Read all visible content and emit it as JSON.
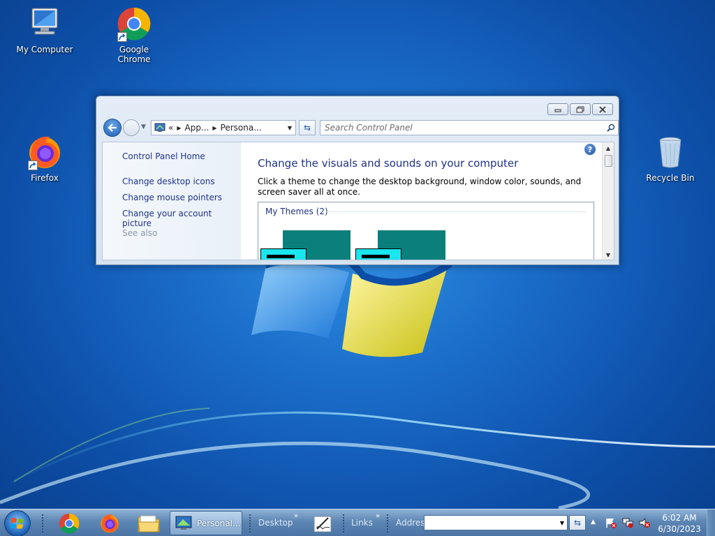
{
  "desktop": {
    "icons": [
      {
        "label": "My Computer",
        "icon": "computer-icon"
      },
      {
        "label": "Google Chrome",
        "icon": "chrome-icon"
      },
      {
        "label": "Firefox",
        "icon": "firefox-icon"
      },
      {
        "label": "Recycle Bin",
        "icon": "recycle-bin-icon"
      }
    ]
  },
  "window": {
    "title_buttons": {
      "minimize": "minimize-icon",
      "restore": "restore-icon",
      "close": "close-icon"
    },
    "address": {
      "overflow": "«",
      "crumbs": [
        "App...",
        "Persona..."
      ]
    },
    "search_placeholder": "Search Control Panel",
    "left_pane": {
      "home": "Control Panel Home",
      "links": [
        "Change desktop icons",
        "Change mouse pointers",
        "Change your account picture"
      ],
      "see_also": "See also"
    },
    "main": {
      "title": "Change the visuals and sounds on your computer",
      "description": "Click a theme to change the desktop background, window color, sounds, and screen saver all at once.",
      "themes_group": "My Themes (2)"
    }
  },
  "taskbar": {
    "active_window_label": "Personal...",
    "toolbars": [
      "Desktop",
      "Links",
      "Address"
    ],
    "overflow": "»",
    "clock": {
      "time": "6:02 AM",
      "date": "6/30/2023"
    },
    "colors": {
      "accent": "#1e3287",
      "taskbar": "#5c86b4"
    }
  }
}
